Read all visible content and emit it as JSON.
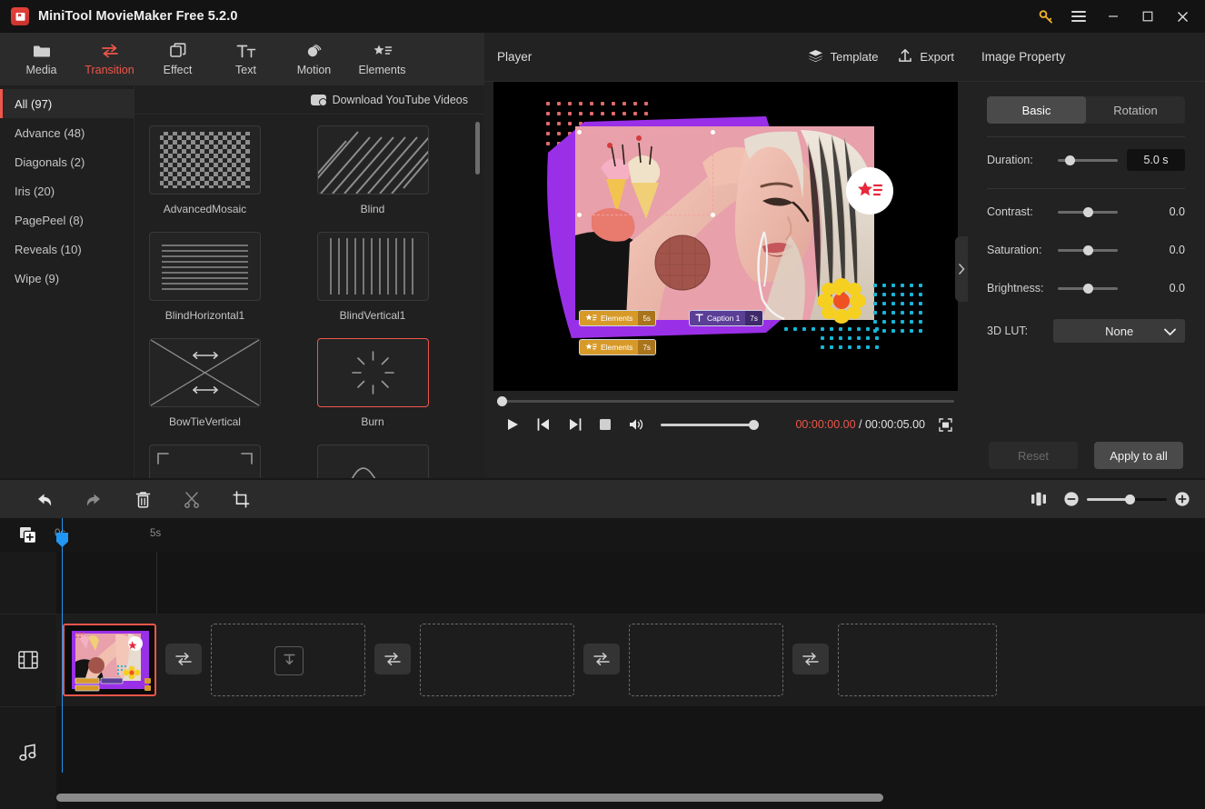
{
  "window": {
    "title": "MiniTool MovieMaker Free 5.2.0",
    "controls": {
      "key": "key-icon",
      "menu": "hamburger-icon",
      "minimize": "–",
      "maximize": "□",
      "close": "✕"
    }
  },
  "ribbon": {
    "items": [
      {
        "label": "Media",
        "icon": "folder-icon",
        "active": false
      },
      {
        "label": "Transition",
        "icon": "transition-arrows-icon",
        "active": true
      },
      {
        "label": "Effect",
        "icon": "layers-icon",
        "active": false
      },
      {
        "label": "Text",
        "icon": "text-icon",
        "active": false
      },
      {
        "label": "Motion",
        "icon": "motion-icon",
        "active": false
      },
      {
        "label": "Elements",
        "icon": "star-list-icon",
        "active": false
      }
    ]
  },
  "library": {
    "categories": [
      {
        "label": "All (97)",
        "active": true
      },
      {
        "label": "Advance (48)",
        "active": false
      },
      {
        "label": "Diagonals (2)",
        "active": false
      },
      {
        "label": "Iris (20)",
        "active": false
      },
      {
        "label": "PagePeel (8)",
        "active": false
      },
      {
        "label": "Reveals (10)",
        "active": false
      },
      {
        "label": "Wipe (9)",
        "active": false
      }
    ],
    "download_label": "Download YouTube Videos",
    "tiles": [
      {
        "label": "AdvancedMosaic",
        "pattern": "checker",
        "selected": false
      },
      {
        "label": "Blind",
        "pattern": "diagonal",
        "selected": false
      },
      {
        "label": "BlindHorizontal1",
        "pattern": "hlines",
        "selected": false
      },
      {
        "label": "BlindVertical1",
        "pattern": "vlines",
        "selected": false
      },
      {
        "label": "BowTieVertical",
        "pattern": "bowtie",
        "selected": false
      },
      {
        "label": "Burn",
        "pattern": "burst",
        "selected": true
      },
      {
        "label": "",
        "pattern": "cloud",
        "selected": false
      },
      {
        "label": "",
        "pattern": "curve",
        "selected": false
      }
    ]
  },
  "player": {
    "title": "Player",
    "template_label": "Template",
    "export_label": "Export",
    "current_time": "00:00:00.00",
    "separator": " / ",
    "total_time": "00:00:05.00",
    "overlay_tags": [
      {
        "kind": "elements",
        "label": "Elements",
        "duration": "5s"
      },
      {
        "kind": "caption",
        "label": "Caption 1",
        "duration": "7s"
      },
      {
        "kind": "elements",
        "label": "Elements",
        "duration": "7s"
      }
    ],
    "colors": {
      "current_time": "#f0564a",
      "accent_purple": "#9a2fe8",
      "accent_yellow": "#d79a28"
    }
  },
  "properties": {
    "title": "Image Property",
    "tabs": [
      {
        "label": "Basic",
        "active": true
      },
      {
        "label": "Rotation",
        "active": false
      }
    ],
    "rows": [
      {
        "label": "Duration:",
        "value": "5.0 s",
        "boxed": true,
        "knob_pct": 18
      },
      {
        "label": "Contrast:",
        "value": "0.0",
        "boxed": false,
        "knob_pct": 50
      },
      {
        "label": "Saturation:",
        "value": "0.0",
        "boxed": false,
        "knob_pct": 50
      },
      {
        "label": "Brightness:",
        "value": "0.0",
        "boxed": false,
        "knob_pct": 50
      }
    ],
    "lut": {
      "label": "3D LUT:",
      "value": "None"
    },
    "buttons": {
      "reset": "Reset",
      "apply": "Apply to all"
    }
  },
  "timeline": {
    "toolbar": [
      {
        "name": "undo",
        "dim": false
      },
      {
        "name": "redo",
        "dim": true
      },
      {
        "name": "delete",
        "dim": false
      },
      {
        "name": "split",
        "dim": true
      },
      {
        "name": "crop",
        "dim": false
      }
    ],
    "zoom": {
      "fit_icon": "fit-to-window-icon",
      "minus": "–",
      "plus": "+",
      "value_pct": 48
    },
    "ruler_ticks": [
      "0s",
      "5s"
    ],
    "add_track_icon": "add-media-icon",
    "tracks": [
      {
        "name": "video-track",
        "icon": "film-icon"
      },
      {
        "name": "audio-track",
        "icon": "music-note-icon"
      }
    ],
    "clips": [
      {
        "name": "image-clip-1",
        "selected": true
      }
    ],
    "empty_slots": 4,
    "transition_slots": 4
  }
}
